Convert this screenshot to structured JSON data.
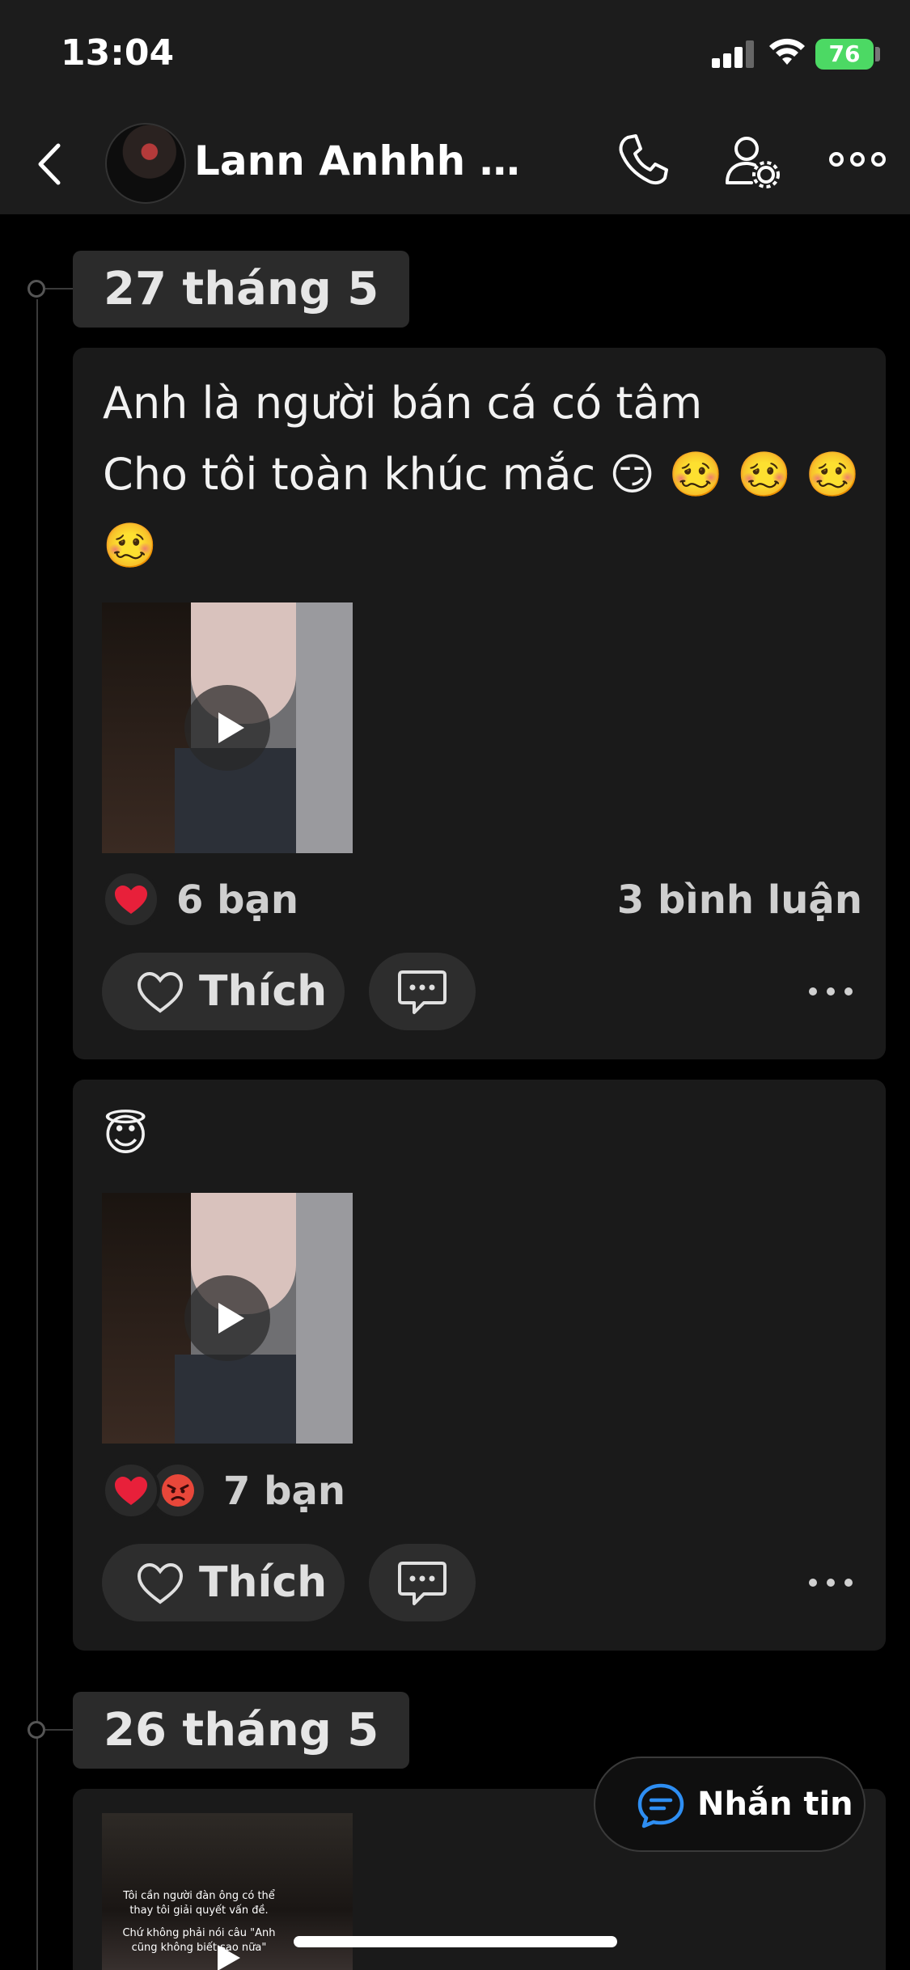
{
  "status_bar": {
    "time": "13:04",
    "battery": "76"
  },
  "header": {
    "title": "Lann Anhhh 0..."
  },
  "timeline": [
    {
      "date": "27 tháng 5",
      "posts": [
        {
          "text_lines": [
            "Anh là người bán cá có tâm",
            "Cho tôi toàn khúc mắc 😏 🥴 🥴 🥴",
            "🥴"
          ],
          "reaction_count": "6 bạn",
          "comment_count": "3 bình luận",
          "reactions": [
            "heart"
          ]
        },
        {
          "text_lines": [
            "😇"
          ],
          "reaction_count": "7 bạn",
          "comment_count": "",
          "reactions": [
            "heart",
            "angry"
          ]
        }
      ]
    },
    {
      "date": "26 tháng 5",
      "posts": [
        {
          "video_caption_1": "Tôi cần người đàn ông có thể thay tôi giải quyết vấn đề.",
          "video_caption_2": "Chứ không phải nói câu \"Anh cũng không biết sao nữa\""
        }
      ]
    }
  ],
  "actions": {
    "like_label": "Thích"
  },
  "fab": {
    "label": "Nhắn tin"
  },
  "colors": {
    "header_bg": "#1c1c1c",
    "card_bg": "#1a1a1a",
    "accent_blue": "#2e8ef2",
    "battery_green": "#4cd964",
    "heart_red": "#e8203a"
  },
  "icons": [
    "back-icon",
    "call-icon",
    "profile-settings-icon",
    "more-icon",
    "heart-icon",
    "comment-icon",
    "play-icon",
    "message-icon"
  ]
}
